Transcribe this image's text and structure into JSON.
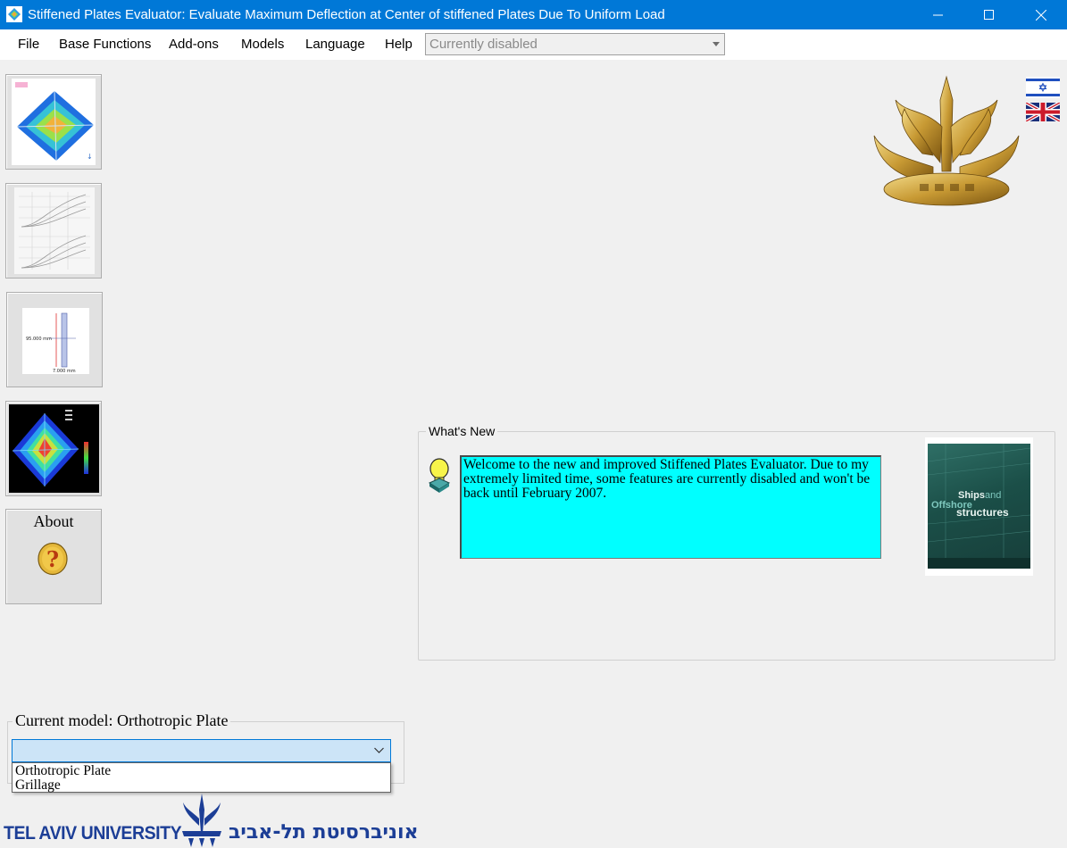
{
  "window": {
    "title": "Stiffened Plates Evaluator: Evaluate Maximum Deflection at Center of stiffened Plates Due To Uniform Load",
    "controls": [
      "minimize-icon",
      "maximize-icon",
      "close-icon"
    ]
  },
  "menu": {
    "items": [
      {
        "label": "File"
      },
      {
        "label": "Base Functions"
      },
      {
        "label": "Add-ons"
      },
      {
        "label": "Models"
      },
      {
        "label": "Language"
      },
      {
        "label": "Help"
      }
    ],
    "status_combo": "Currently disabled"
  },
  "sidebar": {
    "buttons": [
      {
        "name": "deflection-contour-plot",
        "icon": "contour-plot-icon"
      },
      {
        "name": "deflection-curves-graph",
        "icon": "line-graph-icon"
      },
      {
        "name": "stiffener-section-drawing",
        "icon": "section-drawing-icon"
      },
      {
        "name": "fem-3d-plot",
        "icon": "3d-plot-icon"
      },
      {
        "name": "about",
        "icon": "question-mark-icon",
        "label": "About"
      }
    ]
  },
  "languages": [
    "israel-flag-icon",
    "uk-flag-icon"
  ],
  "whats_new": {
    "title": "What's New",
    "message": "Welcome to the new and improved Stiffened Plates Evaluator. Due to my extremely limited time, some features are currently disabled and won't be back until February 2007.",
    "book": {
      "title_line1a": "Ships",
      "title_line1b": "and",
      "title_line2": "Offshore",
      "title_line3": "structures"
    }
  },
  "model": {
    "label": "Current model:",
    "current": "Orthotropic Plate",
    "combo_value": "",
    "options": [
      "Orthotropic Plate",
      "Grillage"
    ]
  },
  "footer": {
    "university_en": "TEL AVIV UNIVERSITY",
    "university_he": "אוניברסיטת תל-אביב"
  },
  "colors": {
    "titlebar": "#0078d7",
    "news_bg": "#00ffff",
    "menubar": "#ffffff"
  }
}
